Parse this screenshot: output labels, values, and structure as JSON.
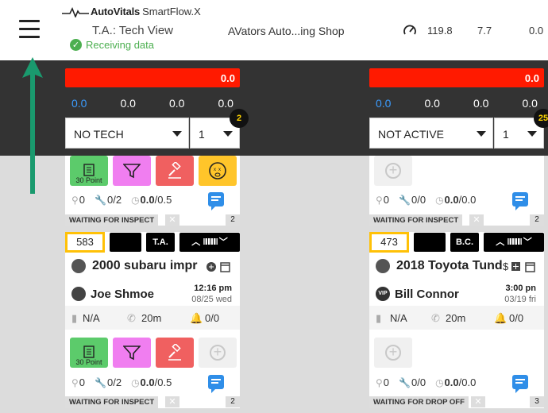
{
  "header": {
    "brand": "AutoVitals",
    "product": "SmartFlow.X",
    "view_title": "T.A.: Tech View",
    "status": "Receiving data",
    "shop_name": "AVators Auto...ing Shop",
    "metric_1": "119.8",
    "metric_2": "7.7",
    "metric_3": "0.0"
  },
  "columns": [
    {
      "redbar_value": "0.0",
      "stats": [
        "0.0",
        "0.0",
        "0.0",
        "0.0"
      ],
      "select_main": "NO TECH",
      "select_num": "1",
      "badge": "2",
      "card_top": {
        "tools": [
          {
            "label": "30 Point",
            "icon": "clipboard-icon"
          },
          {
            "label": "",
            "icon": "filter-icon"
          },
          {
            "label": "",
            "icon": "gavel-icon"
          },
          {
            "label": "",
            "icon": "dizzy-face-icon"
          }
        ],
        "search_count": "0",
        "wrench_count": "0/2",
        "clock_value": "0.0",
        "clock_total": "/0.5",
        "status": "WAITING FOR INSPECT",
        "count": "2"
      },
      "card_main": {
        "ro": "583",
        "tech": "T.A.",
        "vehicle": "2000 subaru impr",
        "customer": "Joe Shmoe",
        "time": "12:16 pm",
        "date": "08/25 wed",
        "na": "N/A",
        "duration": "20m",
        "bell": "0/0",
        "tools": [
          {
            "label": "30 Point",
            "icon": "clipboard-icon"
          },
          {
            "label": "",
            "icon": "filter-icon"
          },
          {
            "label": "",
            "icon": "gavel-icon"
          }
        ],
        "search_count": "0",
        "wrench_count": "0/2",
        "clock_value": "0.0",
        "clock_total": "/0.5",
        "status": "WAITING FOR INSPECT",
        "count": "2"
      }
    },
    {
      "redbar_value": "0.0",
      "stats": [
        "0.0",
        "0.0",
        "0.0",
        "0.0"
      ],
      "select_main": "NOT ACTIVE",
      "select_num": "1",
      "badge": "25",
      "card_top": {
        "search_count": "0",
        "wrench_count": "0/0",
        "clock_value": "0.0",
        "clock_total": "/0.0",
        "status": "WAITING FOR INSPECT",
        "count": "2"
      },
      "card_main": {
        "ro": "473",
        "tech": "B.C.",
        "vehicle": "2018 Toyota Tund",
        "customer": "Bill Connor",
        "vip": "VIP",
        "time": "3:00 pn",
        "date": "03/19 fri",
        "na": "N/A",
        "duration": "20m",
        "bell": "0/0",
        "search_count": "0",
        "wrench_count": "0/0",
        "clock_value": "0.0",
        "clock_total": "/0.0",
        "status": "WAITING FOR DROP OFF",
        "count": "3"
      }
    }
  ],
  "colors": {
    "red_bar": "#ff1a00",
    "band": "#333333",
    "arrow": "#1a9a6e",
    "ro_border": "#ffc107"
  }
}
